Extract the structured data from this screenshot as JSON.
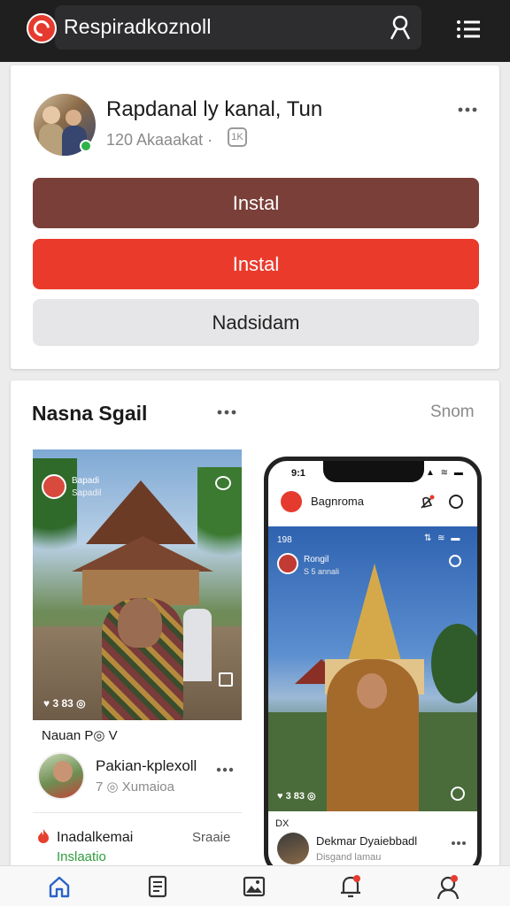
{
  "app": {
    "title": "Respiradkoznoll"
  },
  "header": {
    "logo_icon": "app-logo-icon",
    "profile_icon": "user-outline-icon",
    "menu_icon": "menu-icon"
  },
  "card1": {
    "name": "Rapdanal ly kanal, Tun",
    "subtitle": "120 Akaaakat ·",
    "badge_text": "1K",
    "buttons": {
      "primary_label": "Instal",
      "secondary_label": "Instal",
      "tertiary_label": "Nadsidam"
    },
    "colors": {
      "brown": "#7a3f38",
      "red": "#ea3a2c",
      "grey": "#e6e6e8"
    }
  },
  "card2": {
    "title": "Nasna Sgail",
    "link": "Snom",
    "left_post": {
      "overlay_name": "Bapadi",
      "overlay_sub": "Sapadil",
      "stats": "♥ 3 83 ◎",
      "caption": "Nauan  P◎ V",
      "author": "Pakian-kplexoll",
      "author_sub": "7 ◎ Xumaioa",
      "tag_label": "Inadalkemai",
      "tag_link": "Sraaie",
      "green_label": "Inslaatio"
    },
    "phone": {
      "time": "9:1",
      "status": "▲ ≋ ▬",
      "title": "Bagnroma",
      "overlay_num": "198",
      "overlay_icons": "⇅ ≋ ▬",
      "overlay_name": "Rongil",
      "overlay_sub": "S 5 annali",
      "stats": "♥ 3 83 ◎",
      "caption": "DX",
      "author": "Dekmar Dyaiebbadl",
      "author_sub": "Disgand lamau"
    }
  },
  "bottom_nav": {
    "items": [
      "home-icon",
      "document-icon",
      "gallery-icon",
      "bell-icon",
      "user-icon"
    ]
  }
}
